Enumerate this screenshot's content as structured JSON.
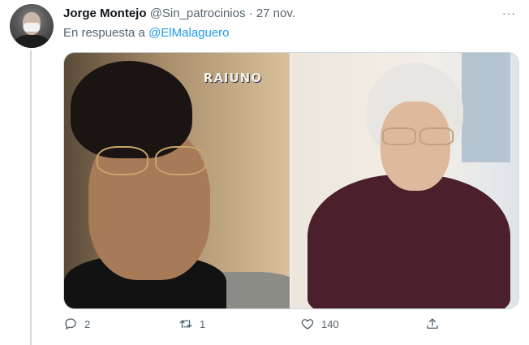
{
  "tweet": {
    "display_name": "Jorge Montejo",
    "handle": "@Sin_patrocinios",
    "separator": "·",
    "date": "27 nov.",
    "more": "···",
    "reply_prefix": "En respuesta a",
    "reply_to": "@ElMalaguero"
  },
  "media": {
    "left_watermark": "RAIUNO"
  },
  "actions": {
    "replies": "2",
    "retweets": "1",
    "likes": "140"
  },
  "colors": {
    "link": "#1d9bf0",
    "secondary_text": "#536471",
    "border": "#cfd9de"
  },
  "icons": [
    "reply-icon",
    "retweet-icon",
    "like-icon",
    "share-icon",
    "more-icon"
  ]
}
